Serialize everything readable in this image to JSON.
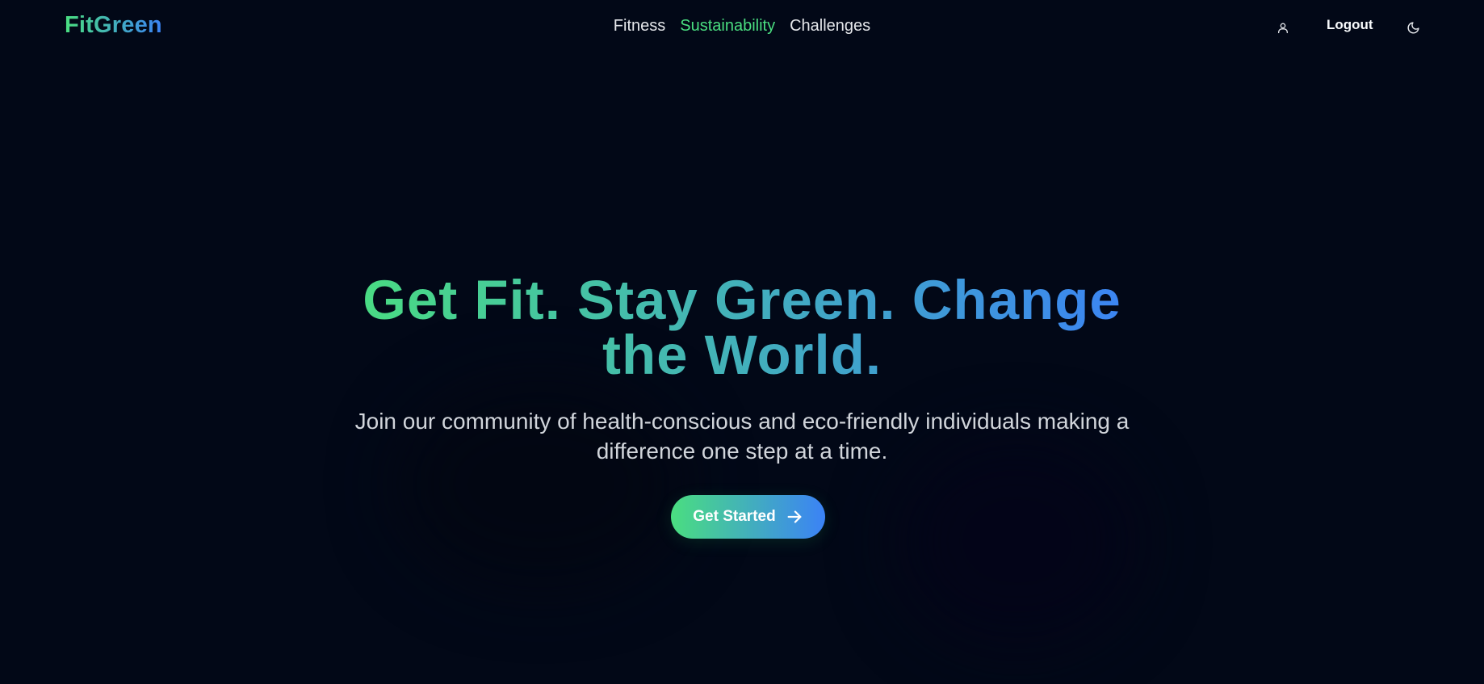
{
  "header": {
    "logo": "FitGreen",
    "nav": [
      {
        "label": "Fitness",
        "active": false
      },
      {
        "label": "Sustainability",
        "active": true
      },
      {
        "label": "Challenges",
        "active": false
      }
    ],
    "user_icon": "user-icon",
    "logout_label": "Logout",
    "theme_icon": "moon-icon"
  },
  "hero": {
    "title": "Get Fit. Stay Green. Change the World.",
    "subtitle": "Join our community of health-conscious and eco-friendly individuals making a difference one step at a time.",
    "cta_label": "Get Started",
    "cta_icon": "arrow-right-icon"
  },
  "colors": {
    "background": "#020817",
    "gradient_start": "#4ade80",
    "gradient_end": "#3b82f6",
    "nav_active": "#4ade80",
    "text": "#e5e7eb"
  }
}
